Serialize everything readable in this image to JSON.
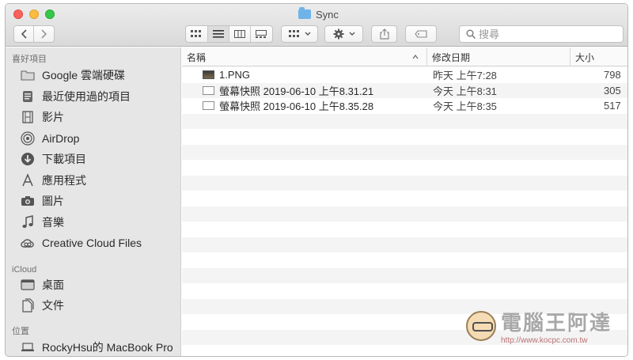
{
  "window": {
    "title": "Sync"
  },
  "toolbar": {
    "back_icon": "chevron-left",
    "forward_icon": "chevron-right",
    "view_icons": [
      "icon-view",
      "list-view",
      "column-view",
      "gallery-view"
    ],
    "arrange_icon": "grid-icon",
    "action_icon": "gear-icon",
    "share_icon": "share-icon",
    "tag_icon": "tag-icon",
    "search": {
      "placeholder": "搜尋",
      "value": ""
    }
  },
  "sidebar": {
    "favorites_label": "喜好項目",
    "favorites": [
      {
        "label": "Google 雲端硬碟",
        "icon": "folder-icon"
      },
      {
        "label": "最近使用過的項目",
        "icon": "recents-icon"
      },
      {
        "label": "影片",
        "icon": "film-icon"
      },
      {
        "label": "AirDrop",
        "icon": "airdrop-icon"
      },
      {
        "label": "下載項目",
        "icon": "download-icon"
      },
      {
        "label": "應用程式",
        "icon": "applications-icon"
      },
      {
        "label": "圖片",
        "icon": "camera-icon"
      },
      {
        "label": "音樂",
        "icon": "music-icon"
      },
      {
        "label": "Creative Cloud Files",
        "icon": "creative-cloud-icon"
      }
    ],
    "icloud_label": "iCloud",
    "icloud": [
      {
        "label": "桌面",
        "icon": "desktop-icon"
      },
      {
        "label": "文件",
        "icon": "document-icon"
      }
    ],
    "locations_label": "位置",
    "locations": [
      {
        "label": "RockyHsu的 MacBook Pro",
        "icon": "laptop-icon"
      }
    ]
  },
  "columns": {
    "name": "名稱",
    "date": "修改日期",
    "size": "大小"
  },
  "files": [
    {
      "name": "1.PNG",
      "date": "昨天 上午7:28",
      "size": "798",
      "icon": "image-file-icon"
    },
    {
      "name": "螢幕快照 2019-06-10 上午8.31.21",
      "date": "今天 上午8:31",
      "size": "305",
      "icon": "screenshot-file-icon"
    },
    {
      "name": "螢幕快照 2019-06-10 上午8.35.28",
      "date": "今天 上午8:35",
      "size": "517",
      "icon": "screenshot-file-icon"
    }
  ],
  "watermark": {
    "title": "電腦王阿達",
    "url": "http://www.kocpc.com.tw"
  },
  "colors": {
    "close": "#fc605b",
    "minimize": "#fdbc40",
    "zoom": "#34c84a",
    "folder": "#6fb4e8"
  }
}
